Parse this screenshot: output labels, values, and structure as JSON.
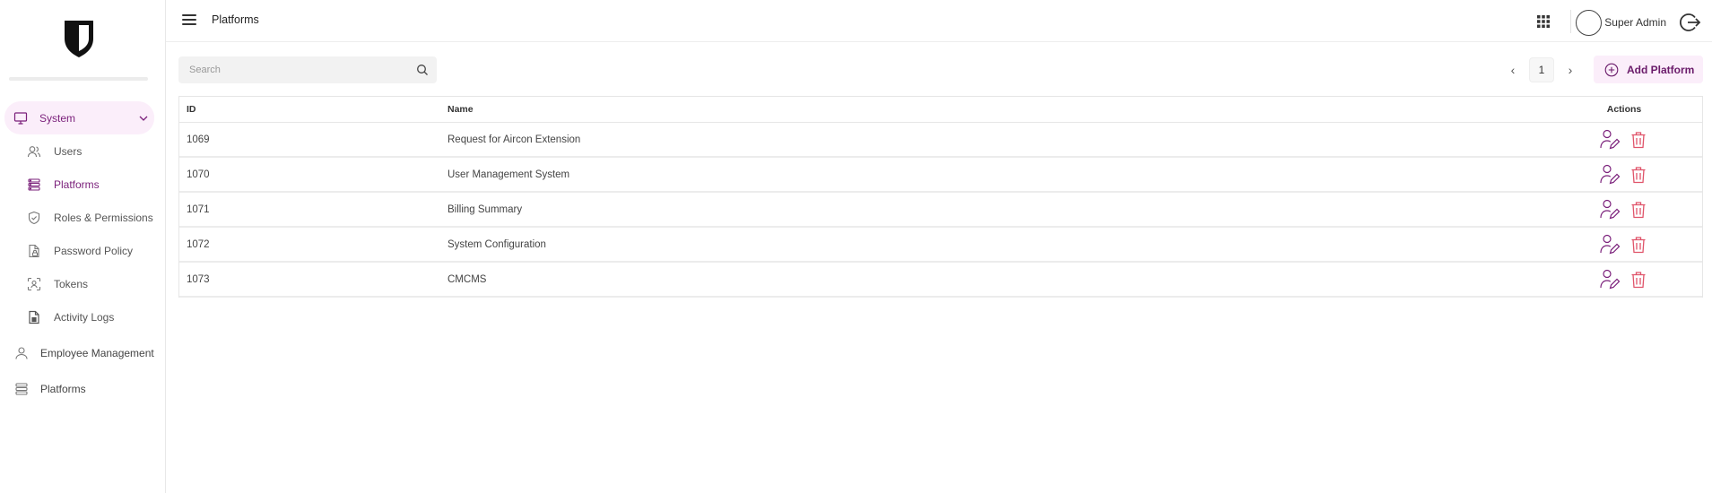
{
  "app": {
    "accent": "#7a1f7a",
    "accent_bg": "#fbeefa",
    "danger": "#e0546a"
  },
  "header": {
    "title": "Platforms",
    "user_name": "Super Admin"
  },
  "sidebar": {
    "system": {
      "label": "System",
      "expanded": true
    },
    "items": [
      {
        "label": "Users",
        "icon": "users-icon"
      },
      {
        "label": "Platforms",
        "icon": "platforms-icon",
        "active": true
      },
      {
        "label": "Roles & Permissions",
        "icon": "shield-icon"
      },
      {
        "label": "Password Policy",
        "icon": "document-lock-icon"
      },
      {
        "label": "Tokens",
        "icon": "token-icon"
      },
      {
        "label": "Activity Logs",
        "icon": "log-file-icon"
      }
    ],
    "employee_management": {
      "label": "Employee Management"
    },
    "platforms": {
      "label": "Platforms"
    }
  },
  "search": {
    "placeholder": "Search",
    "value": ""
  },
  "pagination": {
    "current_page": "1",
    "prev": "‹",
    "next": "›"
  },
  "add_button": {
    "label": "Add Platform"
  },
  "table": {
    "columns": {
      "id": "ID",
      "name": "Name",
      "actions": "Actions"
    },
    "rows": [
      {
        "id": "1069",
        "name": "Request for Aircon Extension"
      },
      {
        "id": "1070",
        "name": "User Management System"
      },
      {
        "id": "1071",
        "name": "Billing Summary"
      },
      {
        "id": "1072",
        "name": "System Configuration"
      },
      {
        "id": "1073",
        "name": "CMCMS"
      }
    ]
  }
}
